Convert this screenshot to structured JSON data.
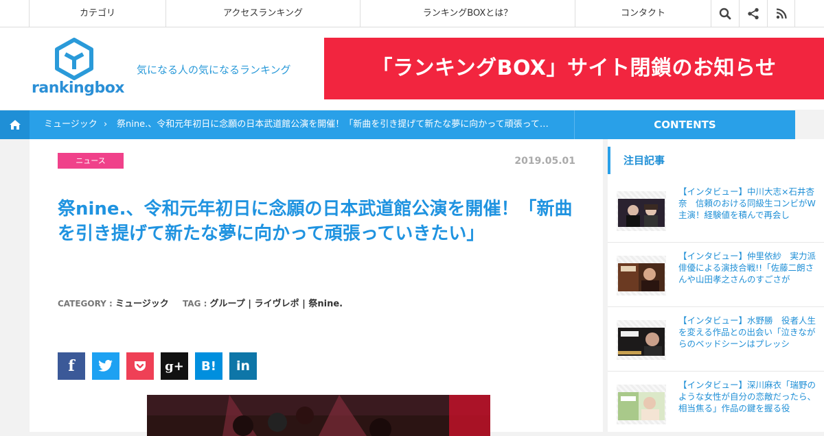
{
  "nav": {
    "items": [
      "カテゴリ",
      "アクセスランキング",
      "ランキングBOXとは？",
      "コンタクト"
    ],
    "icons": [
      "search-icon",
      "share-icon",
      "rss-icon"
    ]
  },
  "header": {
    "logo_text": "rankingbox",
    "tagline": "気になる人の気になるランキング",
    "banner": "「ランキングBOX」サイト閉鎖のお知らせ"
  },
  "breadcrumb": {
    "category": "ミュージック",
    "separator": "›",
    "title": "祭nine.、令和元年初日に念願の日本武道館公演を開催！「新曲を引き提げて新たな夢に向かって頑張って…",
    "contents_label": "CONTENTS"
  },
  "article": {
    "badge": "ニュース",
    "date": "2019.05.01",
    "title": "祭nine.、令和元年初日に念願の日本武道館公演を開催！「新曲を引き提げて新たな夢に向かって頑張っていきたい」",
    "category_label": "CATEGORY :",
    "category": "ミュージック",
    "tag_label": "TAG :",
    "tags": "グループ | ライヴレポ | 祭nine."
  },
  "share": [
    {
      "name": "facebook",
      "glyph": "f",
      "color": "#3b5998"
    },
    {
      "name": "twitter",
      "glyph": "t",
      "color": "#1da1f2"
    },
    {
      "name": "pocket",
      "glyph": "P",
      "color": "#ef4056"
    },
    {
      "name": "googleplus",
      "glyph": "g+",
      "color": "#111111"
    },
    {
      "name": "hatena",
      "glyph": "B!",
      "color": "#008fde"
    },
    {
      "name": "linkedin",
      "glyph": "in",
      "color": "#0e76a8"
    }
  ],
  "sidebar": {
    "heading": "注目記事",
    "articles": [
      {
        "title": "【インタビュー】中川大志×石井杏奈　信頼のおける同級生コンビがW主演！経験値を積んで再会し"
      },
      {
        "title": "【インタビュー】仲里依紗　実力派俳優による演技合戦!!「佐藤二朗さんや山田孝之さんのすごさが"
      },
      {
        "title": "【インタビュー】水野勝　役者人生を変える作品との出会い「泣きながらのベッドシーンはプレッシ"
      },
      {
        "title": "【インタビュー】深川麻衣「瑞野のような女性が自分の恋敵だったら、相当焦る」作品の鍵を握る役"
      }
    ]
  }
}
